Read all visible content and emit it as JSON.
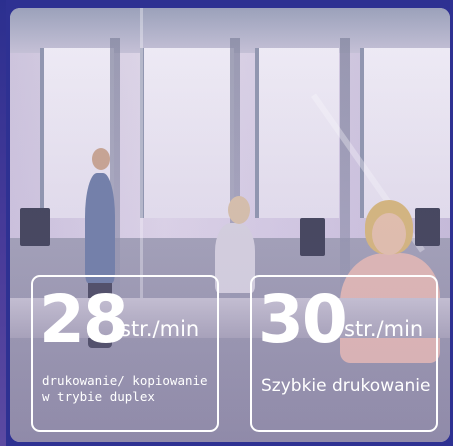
{
  "stats": [
    {
      "number": "28",
      "unit": "str./min",
      "description": "drukowanie/ kopiowanie w trybie duplex"
    },
    {
      "number": "30",
      "unit": "str./min",
      "description": "Szybkie drukowanie"
    }
  ],
  "colors": {
    "background": "#2e3192",
    "box_border": "#ffffff",
    "text": "#ffffff"
  }
}
